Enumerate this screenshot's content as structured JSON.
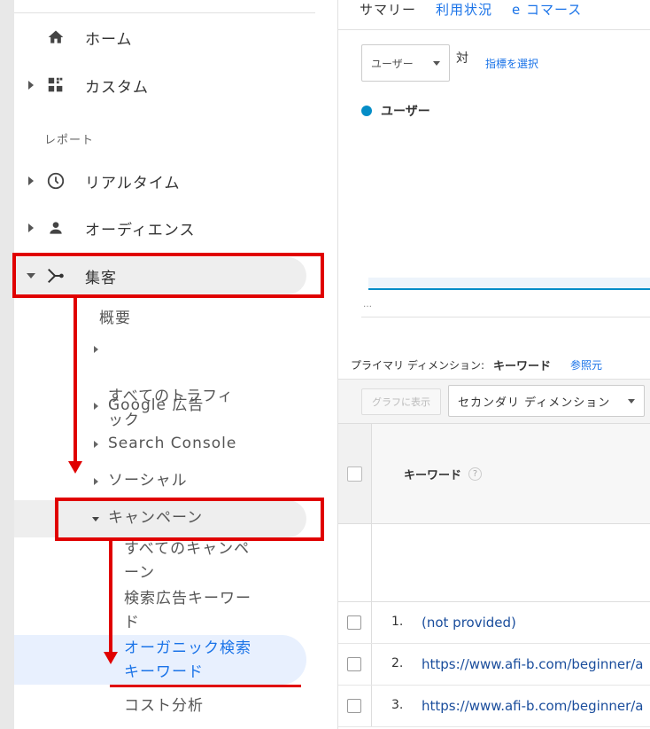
{
  "sidebar": {
    "items": {
      "home": "ホーム",
      "custom": "カスタム",
      "reports_section": "レポート",
      "realtime": "リアルタイム",
      "audience": "オーディエンス",
      "acquisition": "集客"
    },
    "acquisition_sub": {
      "overview": "概要",
      "all_traffic": "すべてのトラフィ\nック",
      "google_ads": "Google 広告",
      "search_console": "Search Console",
      "social": "ソーシャル",
      "campaigns": "キャンペーン"
    },
    "campaign_sub": {
      "all_campaigns": "すべてのキャンペ\nーン",
      "paid_keywords": "検索広告キーワー\nド",
      "organic_keywords": "オーガニック検索\nキーワード",
      "cost_analysis": "コスト分析"
    }
  },
  "main": {
    "tabs": [
      "サマリー",
      "利用状況",
      "e コマース"
    ],
    "metric_select": "ユーザー",
    "vs_label": "対",
    "pick_metric": "指標を選択",
    "legend_label": "ユーザー",
    "chart_tick": "…",
    "primary_dimension_label": "プライマリ ディメンション:",
    "primary_dimension_value": "キーワード",
    "reference_link": "参照元",
    "graph_button": "グラフに表示",
    "secondary_dimension": "セカンダリ ディメンション",
    "table": {
      "header": "キーワード",
      "help": "?",
      "rows": [
        {
          "num": "1.",
          "value": "(not provided)"
        },
        {
          "num": "2.",
          "value": "https://www.afi-b.com/beginner/a"
        },
        {
          "num": "3.",
          "value": "https://www.afi-b.com/beginner/a"
        }
      ]
    }
  },
  "colors": {
    "annotation_red": "#e00000",
    "link_blue": "#1a73e8",
    "series_blue": "#058dc7"
  }
}
